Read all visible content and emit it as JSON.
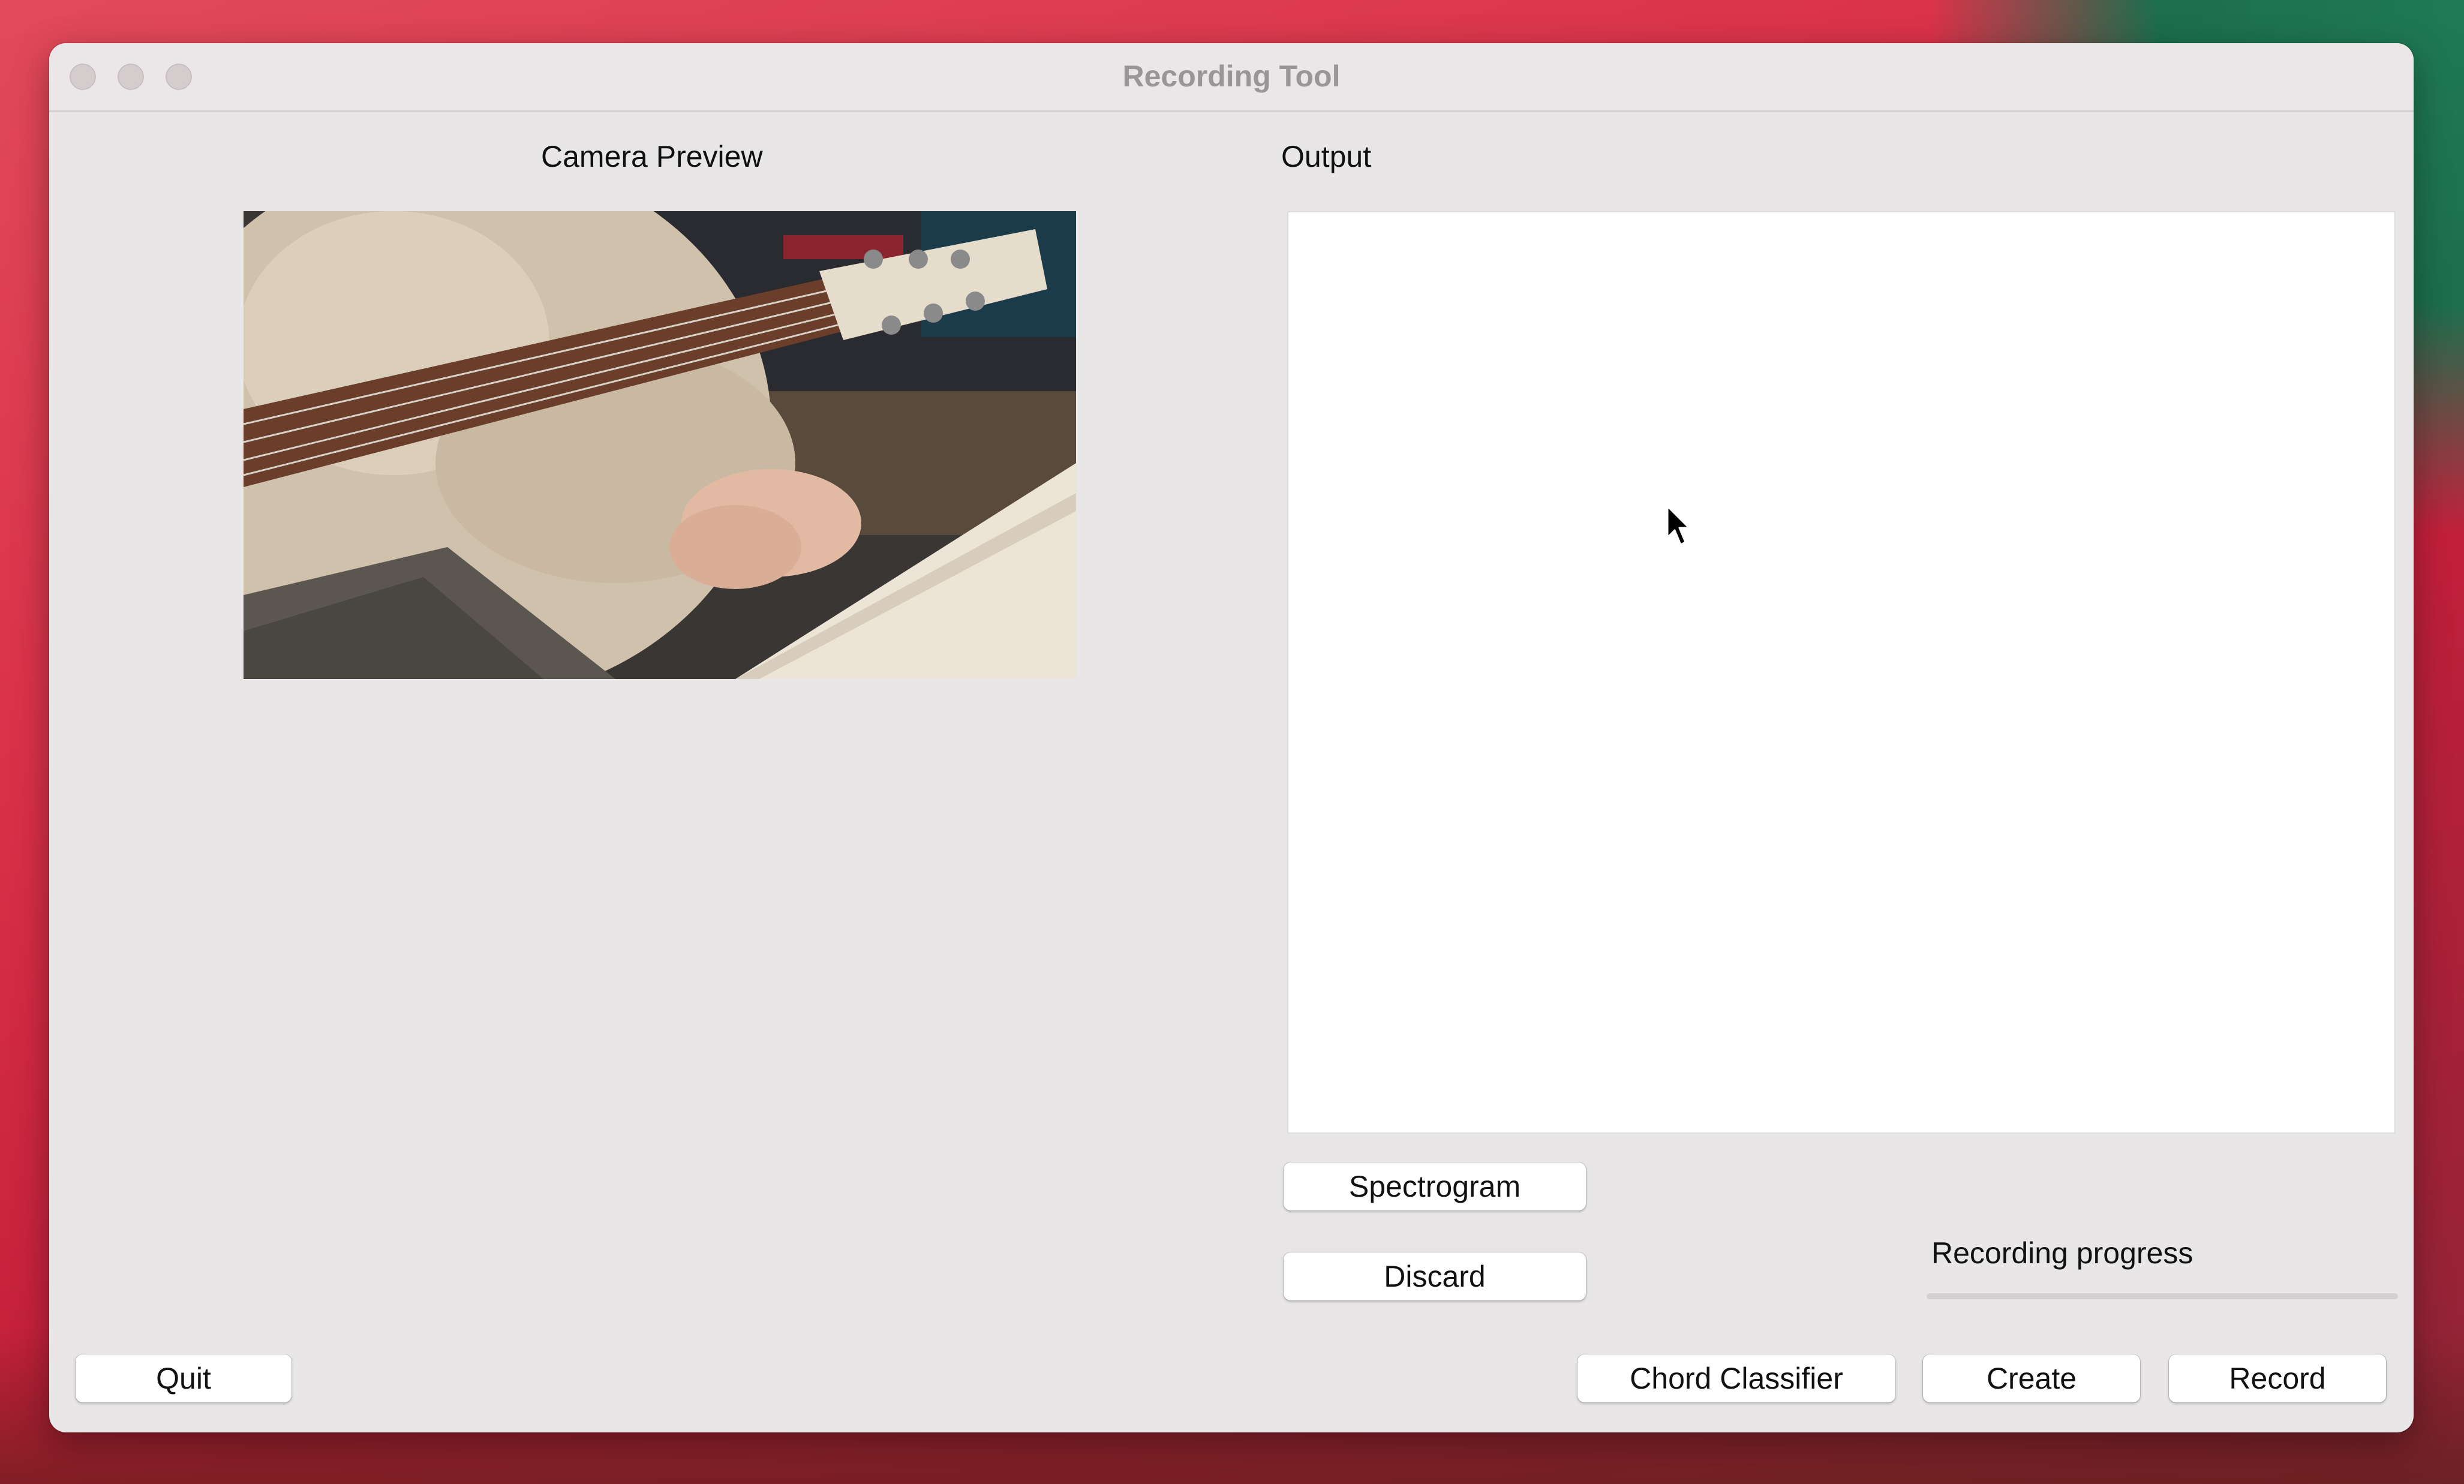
{
  "window": {
    "title": "Recording Tool"
  },
  "camera": {
    "label": "Camera Preview"
  },
  "output": {
    "label": "Output"
  },
  "buttons": {
    "spectrogram": "Spectrogram",
    "discard": "Discard",
    "quit": "Quit",
    "chord_classifier": "Chord Classifier",
    "create": "Create",
    "record": "Record"
  },
  "progress": {
    "label": "Recording progress",
    "value": 0
  },
  "colors": {
    "window_bg": "#e8e6e6",
    "output_bg": "#ffffff",
    "progress_fill": "#2f7cf6"
  }
}
